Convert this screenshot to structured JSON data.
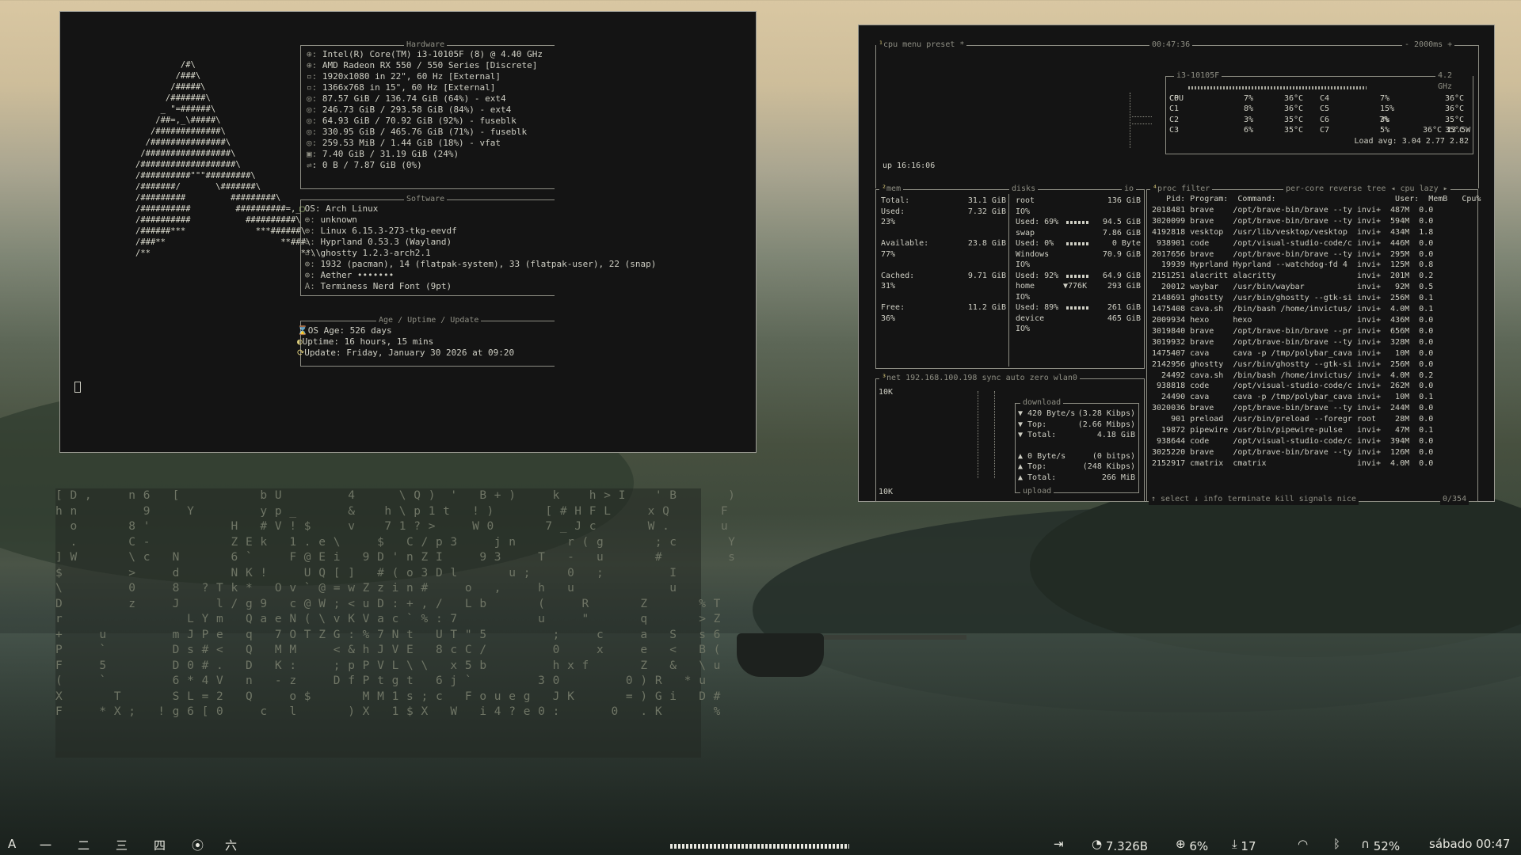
{
  "fastfetch": {
    "hardware_title": "Hardware",
    "hardware": [
      "Intel(R) Core(TM) i3-10105F (8) @ 4.40 GHz",
      "AMD Radeon RX 550 / 550 Series [Discrete]",
      "1920x1080 in 22\", 60 Hz [External]",
      "1366x768 in 15\", 60 Hz [External]",
      "87.57 GiB / 136.74 GiB (64%) - ext4",
      "246.73 GiB / 293.58 GiB (84%) - ext4",
      "64.93 GiB / 70.92 GiB (92%) - fuseblk",
      "330.95 GiB / 465.76 GiB (71%) - fuseblk",
      "259.53 MiB / 1.44 GiB (18%) - vfat",
      "7.40 GiB / 31.19 GiB (24%)",
      ": 0 B / 7.87 GiB (0%)"
    ],
    "software_title": "Software",
    "software": [
      "OS: Arch Linux",
      "unknown",
      "Linux 6.15.3-273-tkg-eevdf",
      "Hyprland 0.53.3 (Wayland)",
      "ghostty 1.2.3-arch2.1",
      "1932 (pacman), 14 (flatpak-system), 33 (flatpak-user), 22 (snap)",
      "Aether •••••••",
      "Terminess Nerd Font (9pt)"
    ],
    "age_title": "Age / Uptime / Update",
    "age": [
      "OS Age: 526 days",
      "Uptime: 16 hours, 15 mins",
      "Update: Friday, January 30 2026 at 09:20"
    ],
    "logo": "         /#\\\n        /###\\\n       /#####\\\n      /#######\\\n     _ \"=######\\\n    /##=,_\\#####\\\n   /#############\\\n  /###############\\\n /#################\\\n/###################\\\n/##########\"\"\"#########\\\n/#######/       \\#######\\\n/#########         #########\\\n/##########         ##########=,_\n/##########           ##########\\\n/######***              ***######\\\n/###**                       **###\\\n/**                              **\\\\"
  },
  "btop": {
    "cpu_header": "cpu",
    "menu": "menu",
    "preset": "preset *",
    "time": "00:47:36",
    "interval": "- 2000ms +",
    "cpu_name": "i3-10105F",
    "freq": "4.2 GHz",
    "cpu_total": "CPU",
    "cpu_pct": "7%",
    "cpu_temp": "36°C 13.5W",
    "cores": [
      {
        "c": "C0",
        "p": "7%",
        "t": "36°C",
        "c2": "C4",
        "p2": "7%",
        "t2": "36°C"
      },
      {
        "c": "C1",
        "p": "8%",
        "t": "36°C",
        "c2": "C5",
        "p2": "15%",
        "t2": "36°C"
      },
      {
        "c": "C2",
        "p": "3%",
        "t": "35°C",
        "c2": "C6",
        "p2": "3%",
        "t2": "35°C"
      },
      {
        "c": "C3",
        "p": "6%",
        "t": "35°C",
        "c2": "C7",
        "p2": "5%",
        "t2": "35°C"
      }
    ],
    "load_avg": "Load avg: 3.04 2.77 2.82",
    "uptime": "up 16:16:06",
    "mem_header": "mem",
    "mem": {
      "total_label": "Total:",
      "total": "31.1 GiB",
      "used_label": "Used:",
      "used": "7.32 GiB",
      "used_pct": "23%",
      "avail_label": "Available:",
      "avail": "23.8 GiB",
      "avail_pct": "77%",
      "cached_label": "Cached:",
      "cached": "9.71 GiB",
      "cached_pct": "31%",
      "free_label": "Free:",
      "free": "11.2 GiB",
      "free_pct": "36%"
    },
    "disks_header": "disks",
    "io": "io",
    "disks": [
      {
        "name": "root",
        "size": "136 GiB",
        "io": "IO%",
        "used": "Used: 69%",
        "val": "94.5 GiB"
      },
      {
        "name": "swap",
        "size": "7.86 GiB",
        "io": "",
        "used": "Used: 0%",
        "val": "0 Byte"
      },
      {
        "name": "Windows",
        "size": "70.9 GiB",
        "io": "IO%",
        "used": "Used: 92%",
        "val": "64.9 GiB"
      },
      {
        "name": "home",
        "size": "293 GiB",
        "io": "IO%",
        "used": "Used: 89%",
        "val": "261 GiB",
        "extra": "▼776K"
      },
      {
        "name": "device",
        "size": "465 GiB",
        "io": "IO%",
        "used": "",
        "val": ""
      }
    ],
    "net_header": "net",
    "net_ip": "192.168.100.198",
    "net_opts": "sync auto zero",
    "net_iface": "wlan0",
    "net_scale_top": "10K",
    "net_scale_bot": "10K",
    "download_title": "download",
    "upload_title": "upload",
    "net_down": [
      {
        "k": "▼ 420 Byte/s",
        "v": "(3.28 Kibps)"
      },
      {
        "k": "▼ Top:",
        "v": "(2.66 Mibps)"
      },
      {
        "k": "▼ Total:",
        "v": "4.18 GiB"
      }
    ],
    "net_up": [
      {
        "k": "▲ 0 Byte/s",
        "v": "(0 bitps)"
      },
      {
        "k": "▲ Top:",
        "v": "(248 Kibps)"
      },
      {
        "k": "▲ Total:",
        "v": "266 MiB"
      }
    ],
    "proc_header": "proc",
    "proc_filter": "filter",
    "proc_opts": "per-core reverse tree ◂ cpu lazy ▸",
    "proc_cols": "   Pid: Program:  Command:                         User:  MemB   Cpu%",
    "procs": [
      "2018481 brave    /opt/brave-bin/brave --ty invi+  487M  0.0",
      "3020099 brave    /opt/brave-bin/brave --ty invi+  594M  0.0",
      "4192818 vesktop  /usr/lib/vesktop/vesktop  invi+  434M  1.8",
      " 938901 code     /opt/visual-studio-code/c invi+  446M  0.0",
      "2017656 brave    /opt/brave-bin/brave --ty invi+  295M  0.0",
      "  19939 Hyprland Hyprland --watchdog-fd 4  invi+  125M  0.8",
      "2151251 alacritt alacritty                 invi+  201M  0.2",
      "  20012 waybar   /usr/bin/waybar           invi+   92M  0.5",
      "2148691 ghostty  /usr/bin/ghostty --gtk-si invi+  256M  0.1",
      "1475408 cava.sh  /bin/bash /home/invictus/ invi+  4.0M  0.1",
      "2009934 hexo     hexo                      invi+  436M  0.0",
      "3019840 brave    /opt/brave-bin/brave --pr invi+  656M  0.0",
      "3019932 brave    /opt/brave-bin/brave --ty invi+  328M  0.0",
      "1475407 cava     cava -p /tmp/polybar_cava invi+   10M  0.0",
      "2142956 ghostty  /usr/bin/ghostty --gtk-si invi+  256M  0.0",
      "  24492 cava.sh  /bin/bash /home/invictus/ invi+  4.0M  0.2",
      " 938818 code     /opt/visual-studio-code/c invi+  262M  0.0",
      "  24490 cava     cava -p /tmp/polybar_cava invi+   10M  0.1",
      "3020036 brave    /opt/brave-bin/brave --ty invi+  244M  0.0",
      "    901 preload  /usr/bin/preload --foregr root    28M  0.0",
      "  19872 pipewire /usr/bin/pipewire-pulse   invi+   47M  0.1",
      " 938644 code     /opt/visual-studio-code/c invi+  394M  0.0",
      "3025220 brave    /opt/brave-bin/brave --ty invi+  126M  0.0",
      "2152917 cmatrix  cmatrix                   invi+  4.0M  0.0"
    ],
    "proc_footer": "↑ select ↓ info terminate kill signals nice",
    "proc_count": "0/354"
  },
  "matrix_lines": [
    "[ D ,     n 6   [           b U         4      \\ Q )  '   B + )     k    h > I    ' B       )",
    "h n         9     Y         y p _       &    h \\ p 1 t   ! )       [ # H F L     x Q       F",
    "  o       8 '           H   # V ! $     v    7 1 ? >     W 0       7 _ J c       W .       u",
    "  .       C -           Z E k   1 . e \\     $   C / p 3     j n       r ( g       ; c       Y",
    "] W       \\ c   N       6 `     F @ E i   9 D ' n Z I     9 3     T   -   u       #         s",
    "$         >     d       N K !     U Q [ ]   # ( o 3 D l       u ;     0   ;         I",
    "\\         0     8   ? T k *   O v ` @ = w Z z i n #     o   ,     h   u             u",
    "D         z     J     l / g 9   c @ W ; < u D : + , /   L b       (     R       Z       % T",
    "r                 L Y m   Q a e N ( \\ v K V a c ` % : 7           u     \"       q       > Z",
    "+     u         m J P e   q   7 O T Z G : % 7 N t   U T \" 5         ;     c     a   S   s 6",
    "P     `         D s # <   Q   M M     < & h J V E   8 c C /         0     x     e   <   B (",
    "F     5         D 0 # .   D   K :     ; p P V L \\ \\   x 5 b         h x f       Z   &   \\ u",
    "(     `         6 * 4 V   n   - z     D f P t g t   6 j `         3 0         0 ) R   * u",
    "X       T       S L = 2   Q     o $       M M 1 s ; c   F o u e g   J K       = ) G i   D #",
    "F     * X ;   ! g 6 [ 0     c   l       ) X   1 $ X   W   i 4 ? e 0 :       0   . K       %"
  ],
  "taskbar": {
    "logo": "A",
    "workspaces": [
      "一",
      "二",
      "三",
      "四",
      "⦿",
      "六"
    ],
    "memory": "7.326B",
    "cpu": "6%",
    "updates": "17",
    "volume": "52%",
    "clock": "sábado 00:47"
  }
}
